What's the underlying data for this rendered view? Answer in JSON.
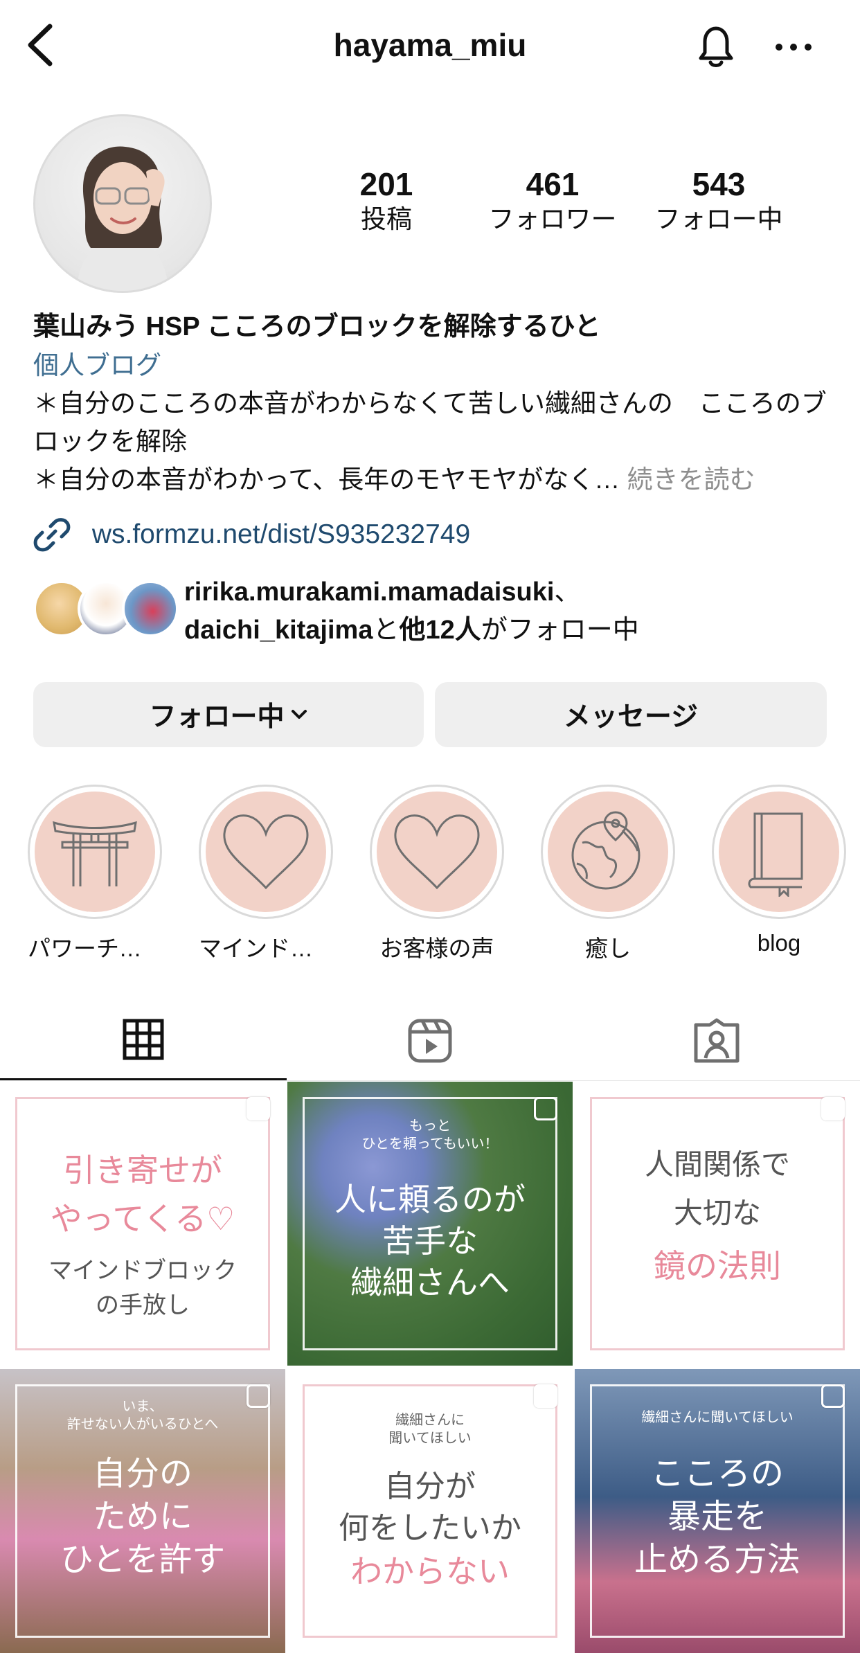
{
  "header": {
    "username": "hayama_miu"
  },
  "stats": [
    {
      "value": "201",
      "label": "投稿"
    },
    {
      "value": "461",
      "label": "フォロワー"
    },
    {
      "value": "543",
      "label": "フォロー中"
    }
  ],
  "bio": {
    "name": "葉山みう HSP こころのブロックを解除するひと",
    "category": "個人ブログ",
    "line1": "＊自分のこころの本音がわからなくて苦しい繊細さんの　こころのブロックを解除",
    "line2": "＊自分の本音がわかって、長年のモヤモヤがなく…",
    "more": "続きを読む",
    "link": "ws.formzu.net/dist/S935232749"
  },
  "mutual": {
    "user1": "ririka.murakami.mamadaisuki",
    "sep": "、",
    "user2": "daichi_kitajima",
    "mid": "と",
    "others": "他12人",
    "tail": "がフォロー中"
  },
  "buttons": {
    "following": "フォロー中",
    "message": "メッセージ"
  },
  "highlights": [
    {
      "label": "パワーチャ…",
      "icon": "torii-icon"
    },
    {
      "label": "マインドブ…",
      "icon": "heart-icon"
    },
    {
      "label": "お客様の声",
      "icon": "heart-icon"
    },
    {
      "label": "癒し",
      "icon": "globe-icon"
    },
    {
      "label": "blog",
      "icon": "book-icon"
    }
  ],
  "posts": [
    {
      "lines": [
        "引き寄せが",
        "やってくる♡",
        "マインドブロック",
        "の手放し"
      ]
    },
    {
      "top": [
        "もっと",
        "ひとを頼ってもいい！"
      ],
      "lines": [
        "人に頼るのが",
        "苦手な",
        "繊細さんへ"
      ]
    },
    {
      "lines": [
        "人間関係で",
        "大切な",
        "鏡の法則"
      ]
    },
    {
      "top": [
        "いま、",
        "許せない人がいるひとへ"
      ],
      "lines": [
        "自分の",
        "ために",
        "ひとを許す"
      ]
    },
    {
      "top": [
        "繊細さんに",
        "聞いてほしい"
      ],
      "lines": [
        "自分が",
        "何をしたいか",
        "わからない"
      ]
    },
    {
      "top": [
        "繊細さんに聞いてほしい"
      ],
      "lines": [
        "こころの",
        "暴走を",
        "止める方法"
      ]
    }
  ],
  "colors": {
    "link": "#3f6e91",
    "highlight_fill": "#f2d2c8",
    "button_bg": "#efefef",
    "pink_text": "#e8899a"
  }
}
